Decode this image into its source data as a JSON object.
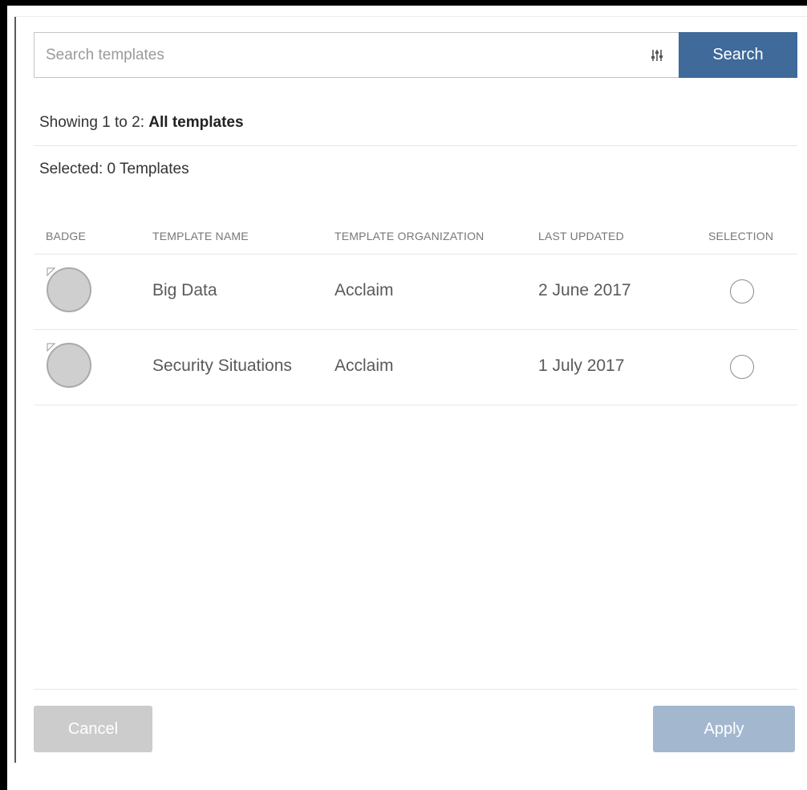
{
  "search": {
    "placeholder": "Search templates",
    "value": "",
    "filter_icon": "sliders-icon",
    "button_label": "Search"
  },
  "status": {
    "showing_prefix": "Showing 1 to 2: ",
    "showing_scope": "All templates",
    "selected": "Selected: 0 Templates"
  },
  "table": {
    "headers": [
      "BADGE",
      "TEMPLATE NAME",
      "TEMPLATE ORGANIZATION",
      "LAST UPDATED",
      "SELECTION"
    ],
    "rows": [
      {
        "badge_icon": "badge-placeholder-icon",
        "name": "Big Data",
        "organization": "Acclaim",
        "last_updated": "2 June 2017",
        "selected": false
      },
      {
        "badge_icon": "badge-placeholder-icon",
        "name": "Security Situations",
        "organization": "Acclaim",
        "last_updated": "1 July 2017",
        "selected": false
      }
    ]
  },
  "footer": {
    "cancel_label": "Cancel",
    "apply_label": "Apply"
  },
  "colors": {
    "primary": "#3f6a99",
    "primary_disabled": "#a3b8cf",
    "cancel_disabled": "#cccccc",
    "badge_fill": "#cfcfcf"
  }
}
